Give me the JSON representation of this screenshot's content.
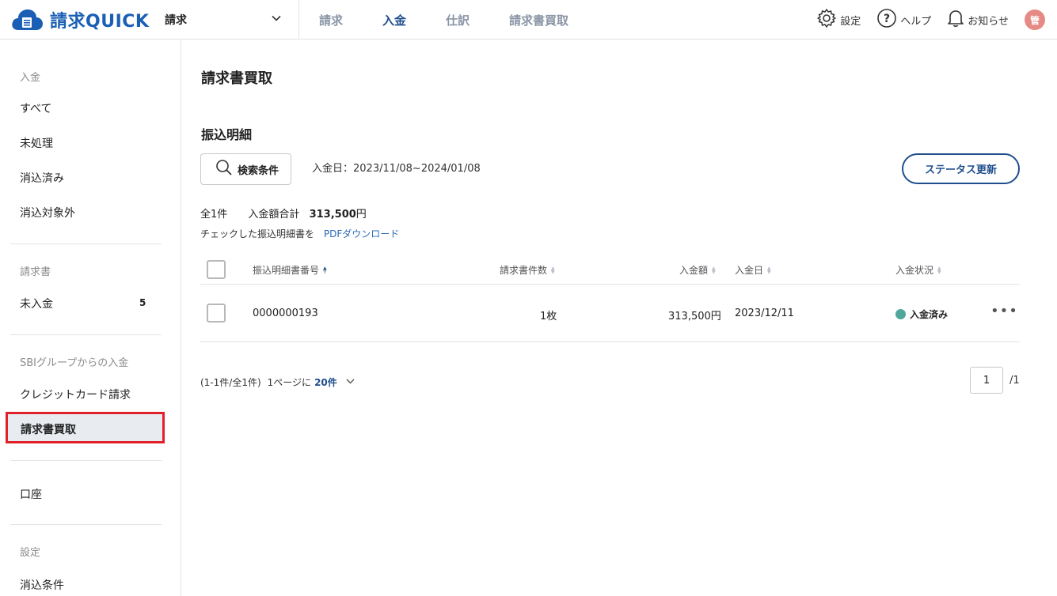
{
  "header": {
    "logo_text": "請求QUICK",
    "app_select": "請求",
    "nav": [
      {
        "label": "請求",
        "active": false
      },
      {
        "label": "入金",
        "active": true
      },
      {
        "label": "仕訳",
        "active": false
      },
      {
        "label": "請求書買取",
        "active": false
      }
    ],
    "tools": {
      "settings": "設定",
      "help": "ヘルプ",
      "notifications": "お知らせ",
      "avatar": "管"
    }
  },
  "sidebar": {
    "section_payment": "入金",
    "items_payment": [
      "すべて",
      "未処理",
      "消込済み",
      "消込対象外"
    ],
    "section_invoice": "請求書",
    "invoice_unpaid": "未入金",
    "invoice_unpaid_badge": "5",
    "section_sbi": "SBIグループからの入金",
    "sbi_credit": "クレジットカード請求",
    "sbi_factoring": "請求書買取",
    "account": "口座",
    "section_settings": "設定",
    "settings_reconcile": "消込条件"
  },
  "main": {
    "page_title": "請求書買取",
    "section_title": "振込明細",
    "search_button": "検索条件",
    "date_range": "入金日：2023/11/08~2024/01/08",
    "status_update_button": "ステータス更新",
    "summary_count": "全1件",
    "summary_total_label": "入金額合計",
    "summary_total_value": "313,500",
    "summary_total_unit": "円",
    "checked_text": "チェックした振込明細書を",
    "pdf_link": "PDFダウンロード",
    "table": {
      "headers": [
        "振込明細書番号",
        "請求書件数",
        "入金額",
        "入金日",
        "入金状況"
      ],
      "rows": [
        {
          "number": "0000000193",
          "count": "1枚",
          "amount": "313,500円",
          "date": "2023/12/11",
          "status": "入金済み"
        }
      ]
    },
    "pager": {
      "range": "(1-1件/全1件)",
      "per_page_label": "1ページに",
      "per_page_value": "20件",
      "current": "1",
      "total": "/1"
    }
  },
  "colors": {
    "accent": "#1f4e8c",
    "highlight_border": "#e0202a",
    "status_paid": "#4fa79b"
  }
}
